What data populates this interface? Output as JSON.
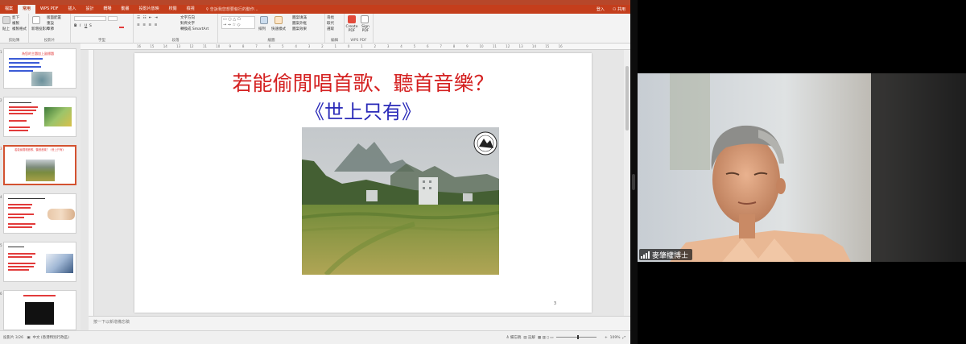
{
  "ribbon_tabs": [
    "檔案",
    "常用",
    "WPS PDF",
    "插入",
    "設計",
    "轉場",
    "動畫",
    "投影片放映",
    "校閱",
    "檢視"
  ],
  "ribbon_active_tab": "常用",
  "search_placeholder": "告訴我您想要執行的動作...",
  "user_label": "登入",
  "share_label": "共用",
  "ribbon": {
    "clipboard": {
      "paste": "貼上",
      "cut": "剪下",
      "copy": "複製",
      "format_painter": "複製格式",
      "label": "剪貼簿"
    },
    "slides": {
      "new_slide": "新增投影片",
      "layout": "版面配置",
      "reset": "重設",
      "section": "章節",
      "label": "投影片"
    },
    "font": {
      "label": "字型"
    },
    "paragraph": {
      "text_direction": "文字方向",
      "align_text": "對齊文字",
      "convert_smartart": "轉換成 SmartArt",
      "label": "段落"
    },
    "drawing": {
      "arrange": "排列",
      "quick_styles": "快速樣式",
      "shape_fill": "圖案填滿",
      "shape_outline": "圖案外框",
      "shape_effects": "圖案效果",
      "label": "繪圖"
    },
    "editing": {
      "find": "尋找",
      "replace": "取代",
      "select": "選取",
      "label": "編輯"
    },
    "wps_pdf": {
      "create_pdf": "Create PDF",
      "sign_pdf": "Sign PDF",
      "label": "WPS PDF"
    }
  },
  "ruler_labels": [
    "16",
    "15",
    "14",
    "13",
    "12",
    "11",
    "10",
    "9",
    "8",
    "7",
    "6",
    "5",
    "4",
    "3",
    "2",
    "1",
    "0",
    "1",
    "2",
    "3",
    "4",
    "5",
    "6",
    "7",
    "8",
    "9",
    "10",
    "11",
    "12",
    "13",
    "14",
    "15",
    "16"
  ],
  "thumbnails": [
    {
      "number": "1",
      "title": "為您的主題加上副標題"
    },
    {
      "number": "2",
      "title": ""
    },
    {
      "number": "3",
      "title": "若能偷閒唱首歌、聽首音樂？《世上只有》"
    },
    {
      "number": "4",
      "title": ""
    },
    {
      "number": "5",
      "title": ""
    },
    {
      "number": "6",
      "title": ""
    }
  ],
  "selected_thumbnail": "3",
  "slide": {
    "title": "若能偷閒唱首歌、聽首音樂？",
    "subtitle": "《世上只有》",
    "page_number": "3"
  },
  "notes_placeholder": "按一下以新增備忘稿",
  "status": {
    "slide_position": "投影片 3/26",
    "language": "中文 (香港特別行政區)",
    "notes_button": "備忘稿",
    "comments_button": "註解",
    "zoom": "109%"
  },
  "participant": {
    "name": "麥肇權博士"
  },
  "colors": {
    "ppt_accent": "#c43e1c",
    "slide_title": "#d42020",
    "slide_subtitle": "#2a2ab8",
    "selected_border": "#d35230"
  }
}
